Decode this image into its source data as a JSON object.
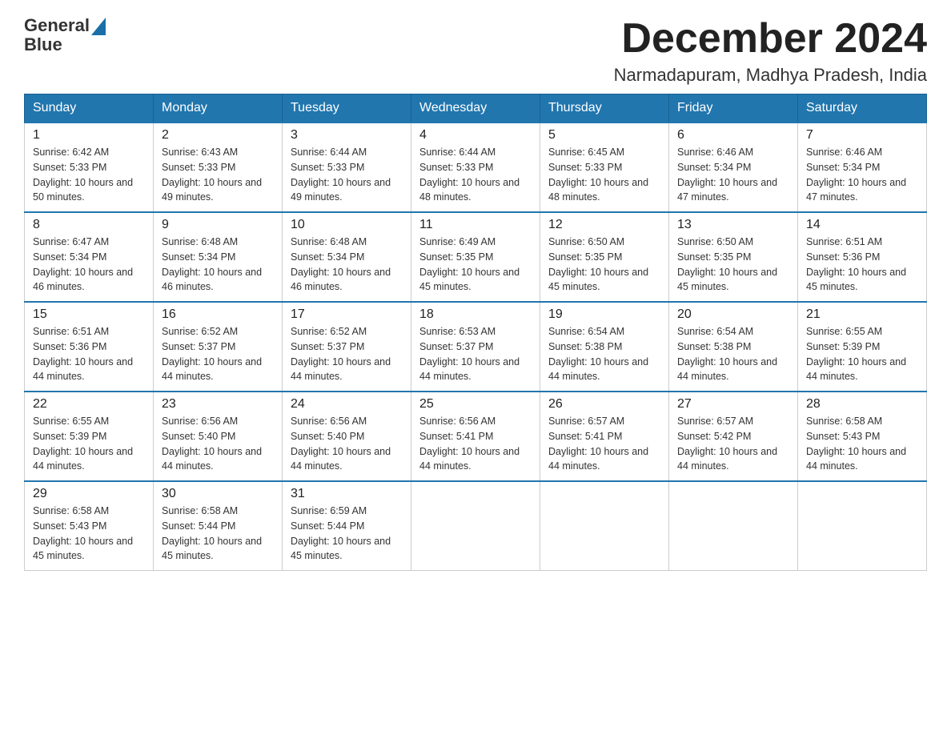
{
  "header": {
    "logo_line1": "General",
    "logo_line2": "Blue",
    "month_title": "December 2024",
    "location": "Narmadapuram, Madhya Pradesh, India"
  },
  "weekdays": [
    "Sunday",
    "Monday",
    "Tuesday",
    "Wednesday",
    "Thursday",
    "Friday",
    "Saturday"
  ],
  "weeks": [
    [
      {
        "day": "1",
        "sunrise": "6:42 AM",
        "sunset": "5:33 PM",
        "daylight": "10 hours and 50 minutes."
      },
      {
        "day": "2",
        "sunrise": "6:43 AM",
        "sunset": "5:33 PM",
        "daylight": "10 hours and 49 minutes."
      },
      {
        "day": "3",
        "sunrise": "6:44 AM",
        "sunset": "5:33 PM",
        "daylight": "10 hours and 49 minutes."
      },
      {
        "day": "4",
        "sunrise": "6:44 AM",
        "sunset": "5:33 PM",
        "daylight": "10 hours and 48 minutes."
      },
      {
        "day": "5",
        "sunrise": "6:45 AM",
        "sunset": "5:33 PM",
        "daylight": "10 hours and 48 minutes."
      },
      {
        "day": "6",
        "sunrise": "6:46 AM",
        "sunset": "5:34 PM",
        "daylight": "10 hours and 47 minutes."
      },
      {
        "day": "7",
        "sunrise": "6:46 AM",
        "sunset": "5:34 PM",
        "daylight": "10 hours and 47 minutes."
      }
    ],
    [
      {
        "day": "8",
        "sunrise": "6:47 AM",
        "sunset": "5:34 PM",
        "daylight": "10 hours and 46 minutes."
      },
      {
        "day": "9",
        "sunrise": "6:48 AM",
        "sunset": "5:34 PM",
        "daylight": "10 hours and 46 minutes."
      },
      {
        "day": "10",
        "sunrise": "6:48 AM",
        "sunset": "5:34 PM",
        "daylight": "10 hours and 46 minutes."
      },
      {
        "day": "11",
        "sunrise": "6:49 AM",
        "sunset": "5:35 PM",
        "daylight": "10 hours and 45 minutes."
      },
      {
        "day": "12",
        "sunrise": "6:50 AM",
        "sunset": "5:35 PM",
        "daylight": "10 hours and 45 minutes."
      },
      {
        "day": "13",
        "sunrise": "6:50 AM",
        "sunset": "5:35 PM",
        "daylight": "10 hours and 45 minutes."
      },
      {
        "day": "14",
        "sunrise": "6:51 AM",
        "sunset": "5:36 PM",
        "daylight": "10 hours and 45 minutes."
      }
    ],
    [
      {
        "day": "15",
        "sunrise": "6:51 AM",
        "sunset": "5:36 PM",
        "daylight": "10 hours and 44 minutes."
      },
      {
        "day": "16",
        "sunrise": "6:52 AM",
        "sunset": "5:37 PM",
        "daylight": "10 hours and 44 minutes."
      },
      {
        "day": "17",
        "sunrise": "6:52 AM",
        "sunset": "5:37 PM",
        "daylight": "10 hours and 44 minutes."
      },
      {
        "day": "18",
        "sunrise": "6:53 AM",
        "sunset": "5:37 PM",
        "daylight": "10 hours and 44 minutes."
      },
      {
        "day": "19",
        "sunrise": "6:54 AM",
        "sunset": "5:38 PM",
        "daylight": "10 hours and 44 minutes."
      },
      {
        "day": "20",
        "sunrise": "6:54 AM",
        "sunset": "5:38 PM",
        "daylight": "10 hours and 44 minutes."
      },
      {
        "day": "21",
        "sunrise": "6:55 AM",
        "sunset": "5:39 PM",
        "daylight": "10 hours and 44 minutes."
      }
    ],
    [
      {
        "day": "22",
        "sunrise": "6:55 AM",
        "sunset": "5:39 PM",
        "daylight": "10 hours and 44 minutes."
      },
      {
        "day": "23",
        "sunrise": "6:56 AM",
        "sunset": "5:40 PM",
        "daylight": "10 hours and 44 minutes."
      },
      {
        "day": "24",
        "sunrise": "6:56 AM",
        "sunset": "5:40 PM",
        "daylight": "10 hours and 44 minutes."
      },
      {
        "day": "25",
        "sunrise": "6:56 AM",
        "sunset": "5:41 PM",
        "daylight": "10 hours and 44 minutes."
      },
      {
        "day": "26",
        "sunrise": "6:57 AM",
        "sunset": "5:41 PM",
        "daylight": "10 hours and 44 minutes."
      },
      {
        "day": "27",
        "sunrise": "6:57 AM",
        "sunset": "5:42 PM",
        "daylight": "10 hours and 44 minutes."
      },
      {
        "day": "28",
        "sunrise": "6:58 AM",
        "sunset": "5:43 PM",
        "daylight": "10 hours and 44 minutes."
      }
    ],
    [
      {
        "day": "29",
        "sunrise": "6:58 AM",
        "sunset": "5:43 PM",
        "daylight": "10 hours and 45 minutes."
      },
      {
        "day": "30",
        "sunrise": "6:58 AM",
        "sunset": "5:44 PM",
        "daylight": "10 hours and 45 minutes."
      },
      {
        "day": "31",
        "sunrise": "6:59 AM",
        "sunset": "5:44 PM",
        "daylight": "10 hours and 45 minutes."
      },
      null,
      null,
      null,
      null
    ]
  ]
}
